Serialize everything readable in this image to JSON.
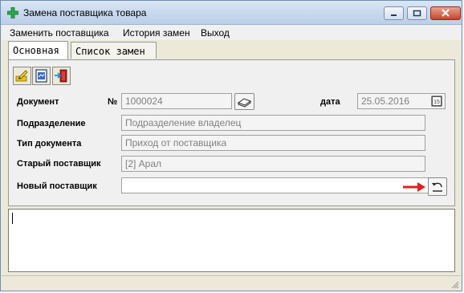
{
  "window": {
    "title": "Замена поставщика товара"
  },
  "menu": {
    "items": [
      {
        "label": "Заменить поставщика"
      },
      {
        "label": "История замен"
      },
      {
        "label": "Выход"
      }
    ]
  },
  "tabs": [
    {
      "label": "Основная",
      "active": true
    },
    {
      "label": "Список замен",
      "active": false
    }
  ],
  "toolbar": {
    "icons": [
      "edit-pencil-icon",
      "document-icon",
      "exit-door-icon"
    ]
  },
  "form": {
    "document_label": "Документ",
    "number_sign": "№",
    "document_number": "1000024",
    "date_label": "дата",
    "date_value": "25.05.2016",
    "calendar_day": "15",
    "department_label": "Подразделение",
    "department_value": "Подразделение владелец",
    "doc_type_label": "Тип документа",
    "doc_type_value": "Приход от поставщика",
    "old_supplier_label": "Старый поставщик",
    "old_supplier_value": "[2] Арал",
    "new_supplier_label": "Новый поставщик",
    "new_supplier_value": ""
  },
  "colors": {
    "arrow": "#e02020",
    "title_bar": "#c9d9ee",
    "close_button": "#c9452c"
  }
}
